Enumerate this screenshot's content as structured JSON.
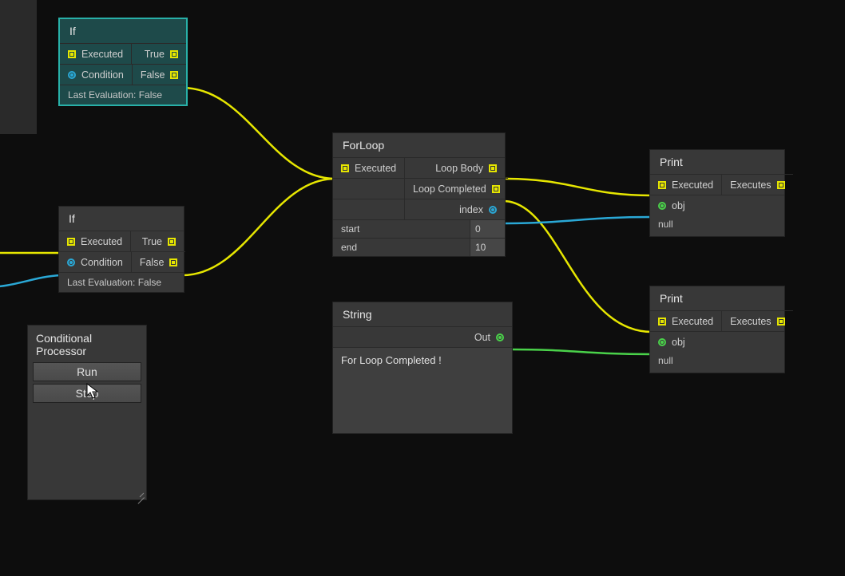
{
  "nodes": {
    "if1": {
      "title": "If",
      "inExec": "Executed",
      "inCond": "Condition",
      "outTrue": "True",
      "outFalse": "False",
      "footer": "Last Evaluation: False"
    },
    "if2": {
      "title": "If",
      "inExec": "Executed",
      "inCond": "Condition",
      "outTrue": "True",
      "outFalse": "False",
      "footer": "Last Evaluation: False"
    },
    "forloop": {
      "title": "ForLoop",
      "inExec": "Executed",
      "outBody": "Loop Body",
      "outCompleted": "Loop Completed",
      "outIndex": "index",
      "startLabel": "start",
      "startValue": "0",
      "endLabel": "end",
      "endValue": "10"
    },
    "string": {
      "title": "String",
      "outLabel": "Out",
      "value": "For Loop Completed !"
    },
    "print1": {
      "title": "Print",
      "inExec": "Executed",
      "outExec": "Executes",
      "inObj": "obj",
      "null": "null"
    },
    "print2": {
      "title": "Print",
      "inExec": "Executed",
      "outExec": "Executes",
      "inObj": "obj",
      "null": "null"
    }
  },
  "panel": {
    "title": "Conditional Processor",
    "run": "Run",
    "step": "Step"
  },
  "colors": {
    "exec": "#e6e600",
    "dataBlue": "#2aa8d6",
    "dataGreen": "#4ad24a"
  }
}
